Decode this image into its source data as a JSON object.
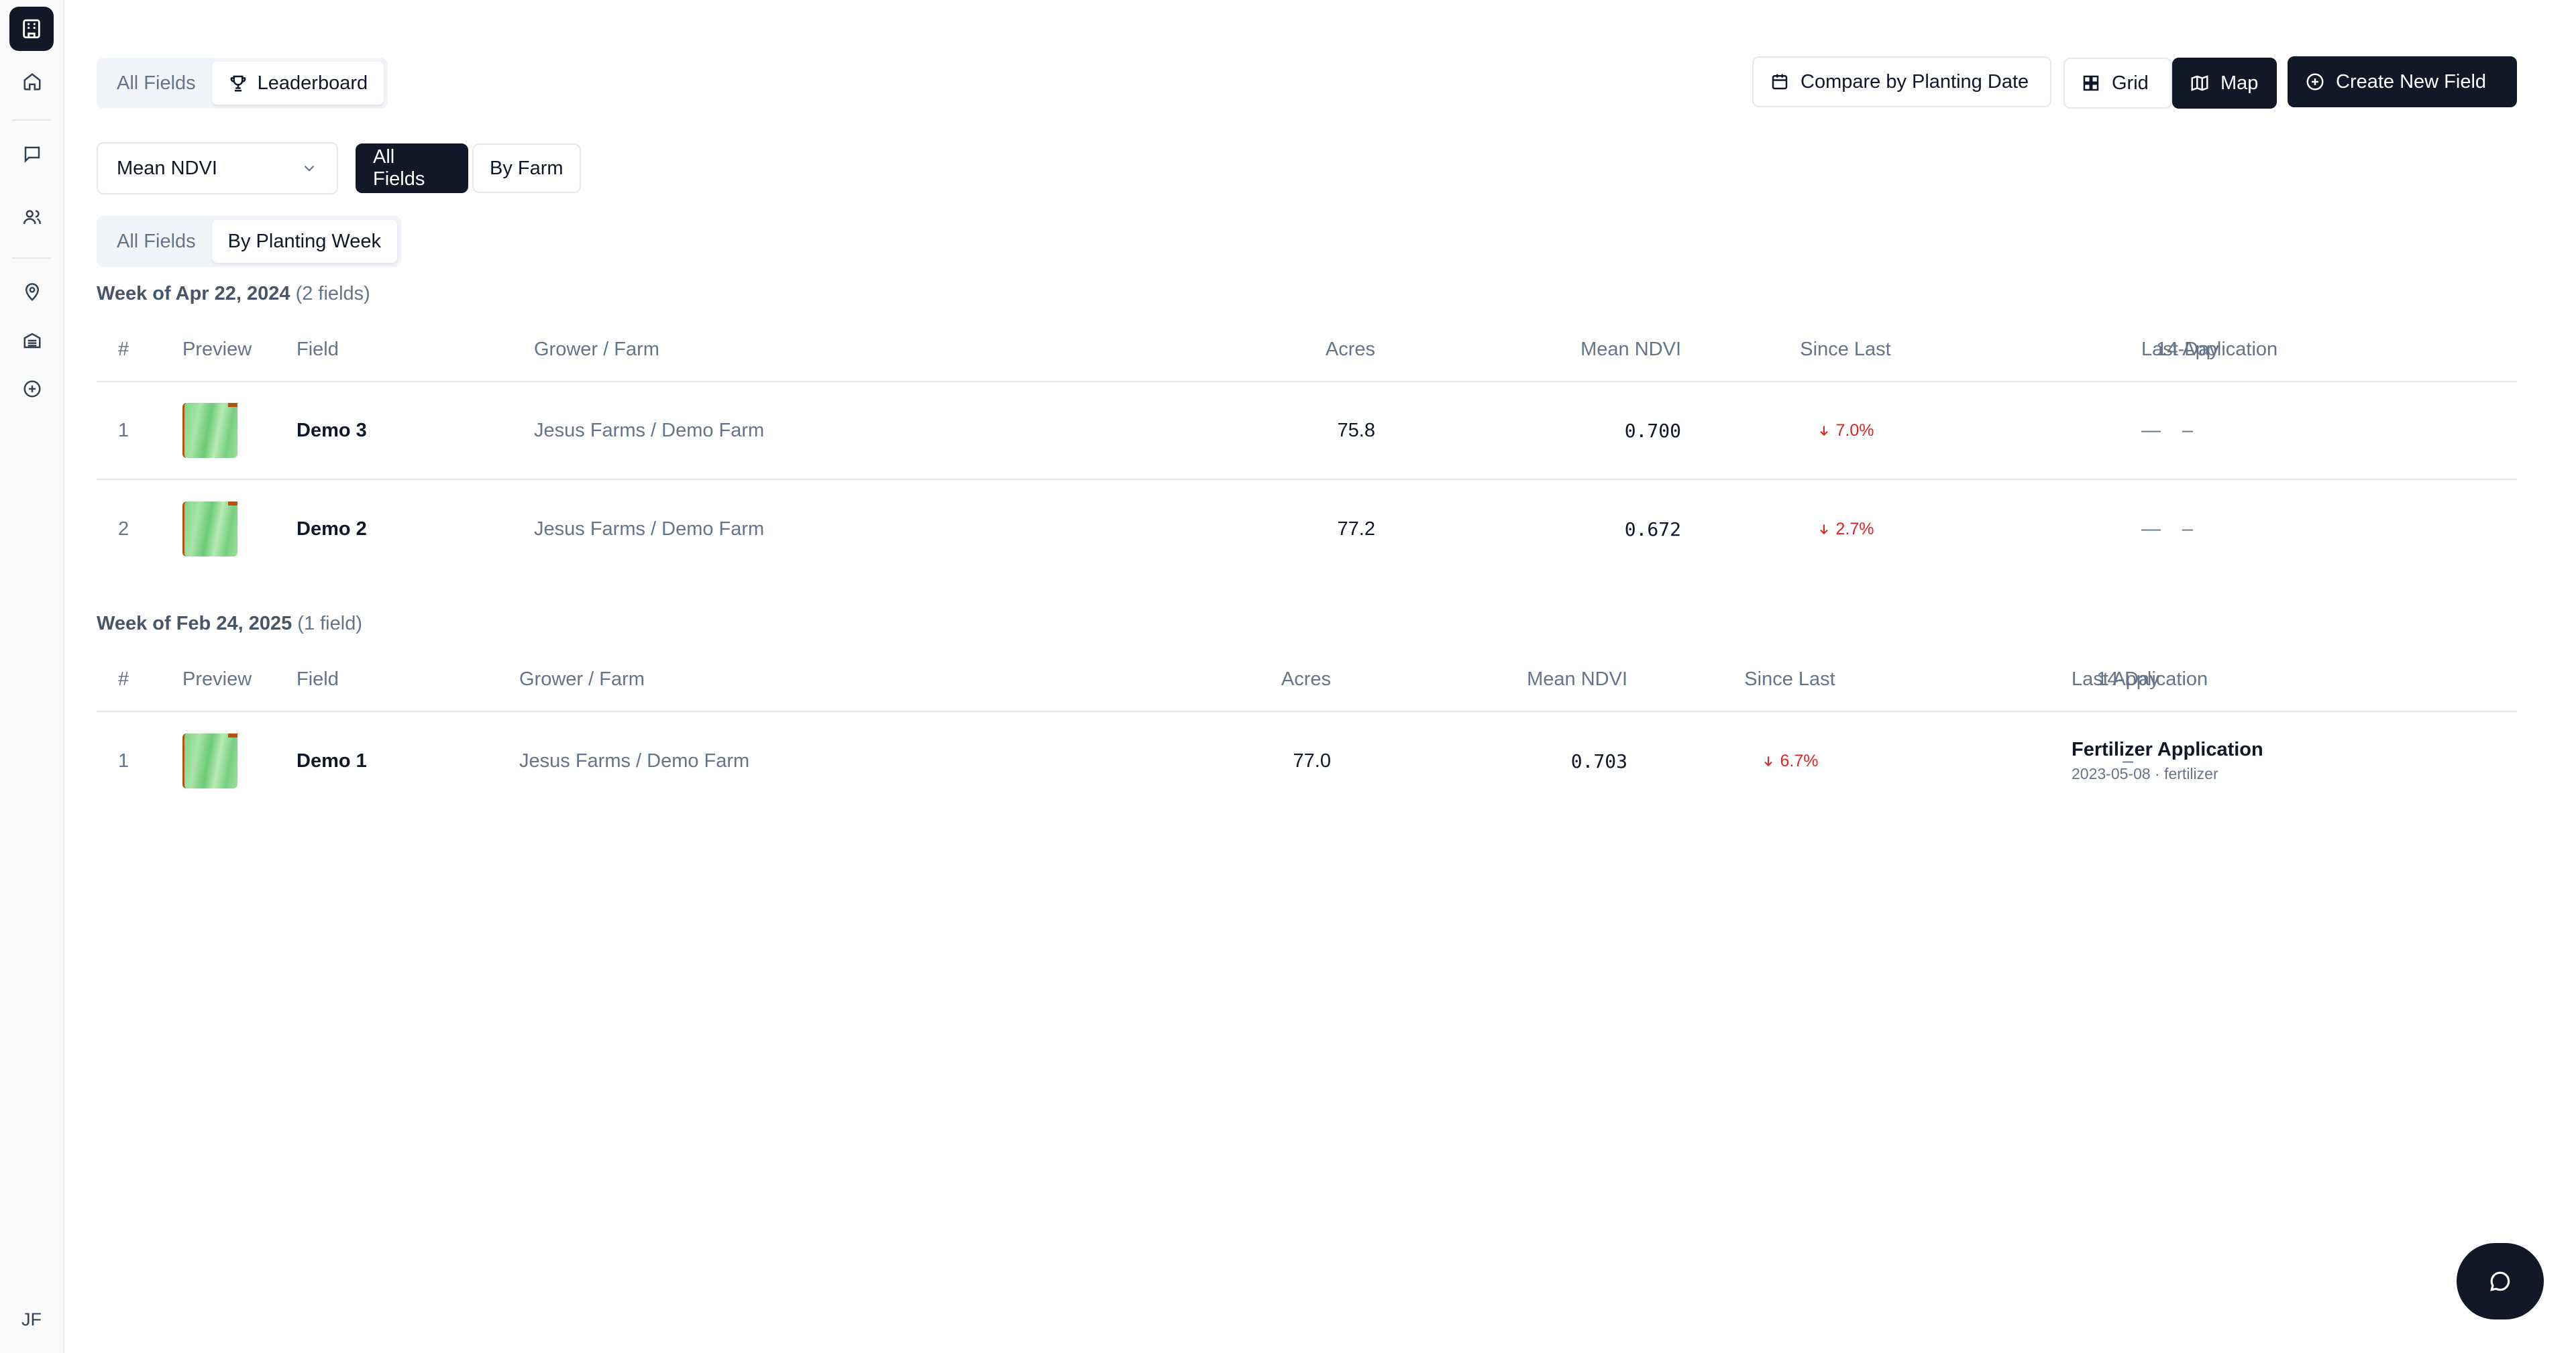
{
  "sidebar": {
    "avatar_initials": "JF"
  },
  "tabs_top": [
    {
      "label": "All Fields",
      "active": false
    },
    {
      "label": "Leaderboard",
      "active": true
    }
  ],
  "toolbar": {
    "compare_label": "Compare by Planting Date",
    "grid_label": "Grid",
    "map_label": "Map",
    "create_label": "Create New Field"
  },
  "metric_select": {
    "value": "Mean NDVI"
  },
  "scope_buttons": [
    {
      "label": "All Fields",
      "active": true
    },
    {
      "label": "By Farm",
      "active": false
    }
  ],
  "group_tabs": [
    {
      "label": "All Fields",
      "active": false
    },
    {
      "label": "By Planting Week",
      "active": true
    }
  ],
  "columns": {
    "rank": "#",
    "preview": "Preview",
    "field": "Field",
    "grower": "Grower / Farm",
    "acres": "Acres",
    "ndvi": "Mean NDVI",
    "since": "Since Last",
    "day14": "14-Day",
    "last_app": "Last Application"
  },
  "groups": [
    {
      "title": "Week of Apr 22, 2024",
      "count": "(2 fields)",
      "rows": [
        {
          "rank": "1",
          "field": "Demo 3",
          "grower": "Jesus Farms / Demo Farm",
          "acres": "75.8",
          "ndvi": "0.700",
          "since": "7.0%",
          "day14": "–",
          "last_app": "—"
        },
        {
          "rank": "2",
          "field": "Demo 2",
          "grower": "Jesus Farms / Demo Farm",
          "acres": "77.2",
          "ndvi": "0.672",
          "since": "2.7%",
          "day14": "–",
          "last_app": "—"
        }
      ]
    },
    {
      "title": "Week of Feb 24, 2025",
      "count": "(1 field)",
      "rows": [
        {
          "rank": "1",
          "field": "Demo 1",
          "grower": "Jesus Farms / Demo Farm",
          "acres": "77.0",
          "ndvi": "0.703",
          "since": "6.7%",
          "day14": "–",
          "last_app_title": "Fertilizer Application",
          "last_app_sub": "2023-05-08 · fertilizer"
        }
      ]
    }
  ]
}
